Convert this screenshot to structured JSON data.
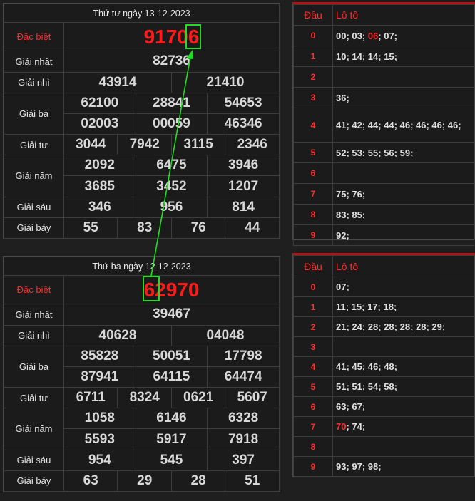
{
  "results": [
    {
      "date_title": "Thứ tư ngày 13-12-2023",
      "labels": {
        "db": "Đặc biệt",
        "g1": "Giải nhất",
        "g2": "Giải nhì",
        "g3": "Giải ba",
        "g4": "Giải tư",
        "g5": "Giải năm",
        "g6": "Giải sáu",
        "g7": "Giải bảy"
      },
      "db": "91706",
      "g1": "82736",
      "g2": [
        "43914",
        "21410"
      ],
      "g3": [
        "62100",
        "28841",
        "54653",
        "02003",
        "00059",
        "46346"
      ],
      "g4": [
        "3044",
        "7942",
        "3115",
        "2346"
      ],
      "g5": [
        "2092",
        "6475",
        "3946",
        "3685",
        "3452",
        "1207"
      ],
      "g6": [
        "346",
        "956",
        "814"
      ],
      "g7": [
        "55",
        "83",
        "76",
        "44"
      ]
    },
    {
      "date_title": "Thứ ba ngày 12-12-2023",
      "labels": {
        "db": "Đặc biệt",
        "g1": "Giải nhất",
        "g2": "Giải nhì",
        "g3": "Giải ba",
        "g4": "Giải tư",
        "g5": "Giải năm",
        "g6": "Giải sáu",
        "g7": "Giải bảy"
      },
      "db": "62970",
      "g1": "39467",
      "g2": [
        "40628",
        "04048"
      ],
      "g3": [
        "85828",
        "50051",
        "17798",
        "87941",
        "64115",
        "64474"
      ],
      "g4": [
        "6711",
        "8324",
        "0621",
        "5607"
      ],
      "g5": [
        "1058",
        "6146",
        "6328",
        "5593",
        "5917",
        "7918"
      ],
      "g6": [
        "954",
        "545",
        "397"
      ],
      "g7": [
        "63",
        "29",
        "28",
        "51"
      ]
    }
  ],
  "loto": [
    {
      "head_label": "Đầu",
      "loto_label": "Lô tô",
      "rows": [
        {
          "dau": "0",
          "pre": "00; 03; ",
          "hl": "06",
          "post": "; 07;"
        },
        {
          "dau": "1",
          "pre": "10; 14; 14; 15;",
          "hl": "",
          "post": ""
        },
        {
          "dau": "2",
          "pre": "",
          "hl": "",
          "post": ""
        },
        {
          "dau": "3",
          "pre": "36;",
          "hl": "",
          "post": ""
        },
        {
          "dau": "4",
          "pre": "41; 42; 44; 44; 46; 46; 46; 46;",
          "hl": "",
          "post": ""
        },
        {
          "dau": "5",
          "pre": "52; 53; 55; 56; 59;",
          "hl": "",
          "post": ""
        },
        {
          "dau": "6",
          "pre": "",
          "hl": "",
          "post": ""
        },
        {
          "dau": "7",
          "pre": "75; 76;",
          "hl": "",
          "post": ""
        },
        {
          "dau": "8",
          "pre": "83; 85;",
          "hl": "",
          "post": ""
        },
        {
          "dau": "9",
          "pre": "92;",
          "hl": "",
          "post": ""
        }
      ]
    },
    {
      "head_label": "Đầu",
      "loto_label": "Lô tô",
      "rows": [
        {
          "dau": "0",
          "pre": "07;",
          "hl": "",
          "post": ""
        },
        {
          "dau": "1",
          "pre": "11; 15; 17; 18;",
          "hl": "",
          "post": ""
        },
        {
          "dau": "2",
          "pre": "21; 24; 28; 28; 28; 28; 29;",
          "hl": "",
          "post": ""
        },
        {
          "dau": "3",
          "pre": "",
          "hl": "",
          "post": ""
        },
        {
          "dau": "4",
          "pre": "41; 45; 46; 48;",
          "hl": "",
          "post": ""
        },
        {
          "dau": "5",
          "pre": "51; 51; 54; 58;",
          "hl": "",
          "post": ""
        },
        {
          "dau": "6",
          "pre": "63; 67;",
          "hl": "",
          "post": ""
        },
        {
          "dau": "7",
          "pre": "",
          "hl": "70",
          "post": "; 74;"
        },
        {
          "dau": "8",
          "pre": "",
          "hl": "",
          "post": ""
        },
        {
          "dau": "9",
          "pre": "93; 97; 98;",
          "hl": "",
          "post": ""
        }
      ]
    }
  ]
}
